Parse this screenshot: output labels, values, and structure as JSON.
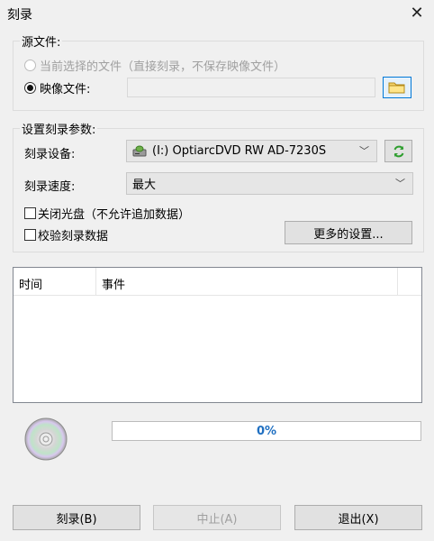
{
  "window": {
    "title": "刻录"
  },
  "source": {
    "label": "源文件:",
    "option_current": "当前选择的文件（直接刻录，不保存映像文件）",
    "option_image": "映像文件:",
    "image_path": ""
  },
  "params": {
    "label": "设置刻录参数:",
    "device_label": "刻录设备:",
    "device_value": "(I:) OptiarcDVD RW AD-7230S",
    "speed_label": "刻录速度:",
    "speed_value": "最大",
    "close_disc": "关闭光盘（不允许追加数据）",
    "verify": "校验刻录数据",
    "more_settings": "更多的设置..."
  },
  "log": {
    "columns": [
      "时间",
      "事件"
    ],
    "rows": []
  },
  "progress": {
    "value": 0,
    "text": "0%"
  },
  "buttons": {
    "burn": "刻录(B)",
    "stop": "中止(A)",
    "exit": "退出(X)"
  },
  "icons": {
    "close": "close-icon",
    "folder": "folder-icon",
    "refresh": "refresh-icon",
    "drive": "drive-icon",
    "disc": "disc-icon"
  }
}
